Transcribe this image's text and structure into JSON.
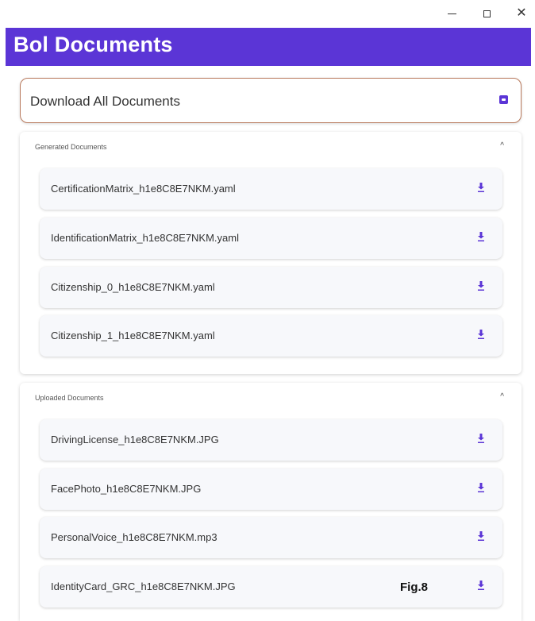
{
  "window": {
    "minimize_glyph": "–",
    "maximize_glyph": "□",
    "close_glyph": "✕"
  },
  "header": {
    "title": "Bol Documents",
    "color": "#5b35d6"
  },
  "download_all": {
    "label": "Download All Documents",
    "icon": "archive-download-icon"
  },
  "generated": {
    "title": "Generated Documents",
    "caret": "^",
    "items": [
      {
        "name": "CertificationMatrix_h1e8C8E7NKM.yaml"
      },
      {
        "name": "IdentificationMatrix_h1e8C8E7NKM.yaml"
      },
      {
        "name": "Citizenship_0_h1e8C8E7NKM.yaml"
      },
      {
        "name": "Citizenship_1_h1e8C8E7NKM.yaml"
      }
    ]
  },
  "uploaded": {
    "title": "Uploaded Documents",
    "caret": "^",
    "items": [
      {
        "name": "DrivingLicense_h1e8C8E7NKM.JPG"
      },
      {
        "name": "FacePhoto_h1e8C8E7NKM.JPG"
      },
      {
        "name": "PersonalVoice_h1e8C8E7NKM.mp3"
      },
      {
        "name": "IdentityCard_GRC_h1e8C8E7NKM.JPG"
      }
    ]
  },
  "figure_label": "Fig.8",
  "colors": {
    "accent": "#5b35d6",
    "download_border": "#b97b5e",
    "item_background": "#f7f8fb"
  }
}
